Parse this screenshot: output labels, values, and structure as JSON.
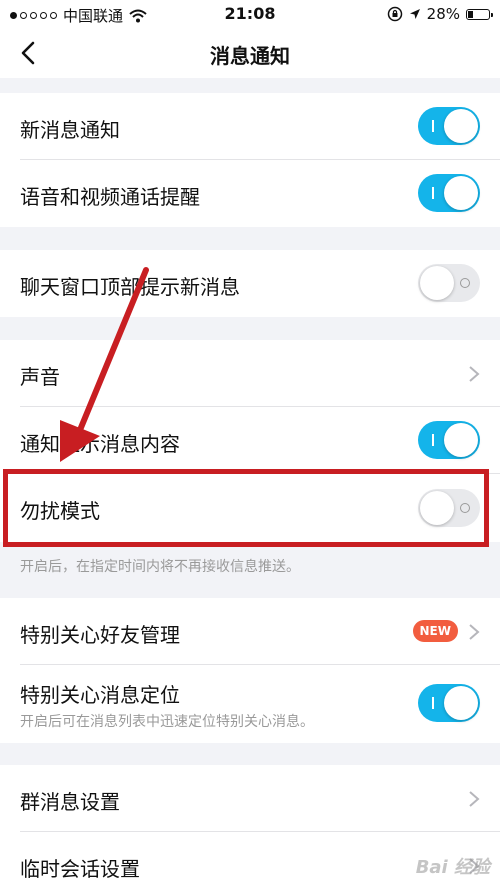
{
  "status_bar": {
    "carrier": "中国联通",
    "time": "21:08",
    "battery": "28%",
    "battery_level": 0.28
  },
  "nav": {
    "title": "消息通知"
  },
  "rows": {
    "new_message": {
      "label": "新消息通知",
      "enabled": true
    },
    "voice_video": {
      "label": "语音和视频通话提醒",
      "enabled": true
    },
    "chat_top": {
      "label": "聊天窗口顶部提示新消息",
      "enabled": false
    },
    "sound": {
      "label": "声音"
    },
    "show_content": {
      "label": "通知显示消息内容",
      "enabled": true
    },
    "dnd": {
      "label": "勿扰模式",
      "enabled": false
    },
    "dnd_note": "开启后，在指定时间内将不再接收信息推送。",
    "special_friends": {
      "label": "特别关心好友管理",
      "badge": "NEW"
    },
    "special_locate": {
      "label": "特别关心消息定位",
      "sub": "开启后可在消息列表中迅速定位特别关心消息。",
      "enabled": true
    },
    "group_settings": {
      "label": "群消息设置"
    },
    "temp_session": {
      "label": "临时会话设置"
    }
  },
  "watermark": "Bai 经验",
  "colors": {
    "toggle_on": "#14b4ea",
    "toggle_off": "#e8e9ec",
    "badge": "#f25d3f",
    "annotation": "#c81e22"
  }
}
